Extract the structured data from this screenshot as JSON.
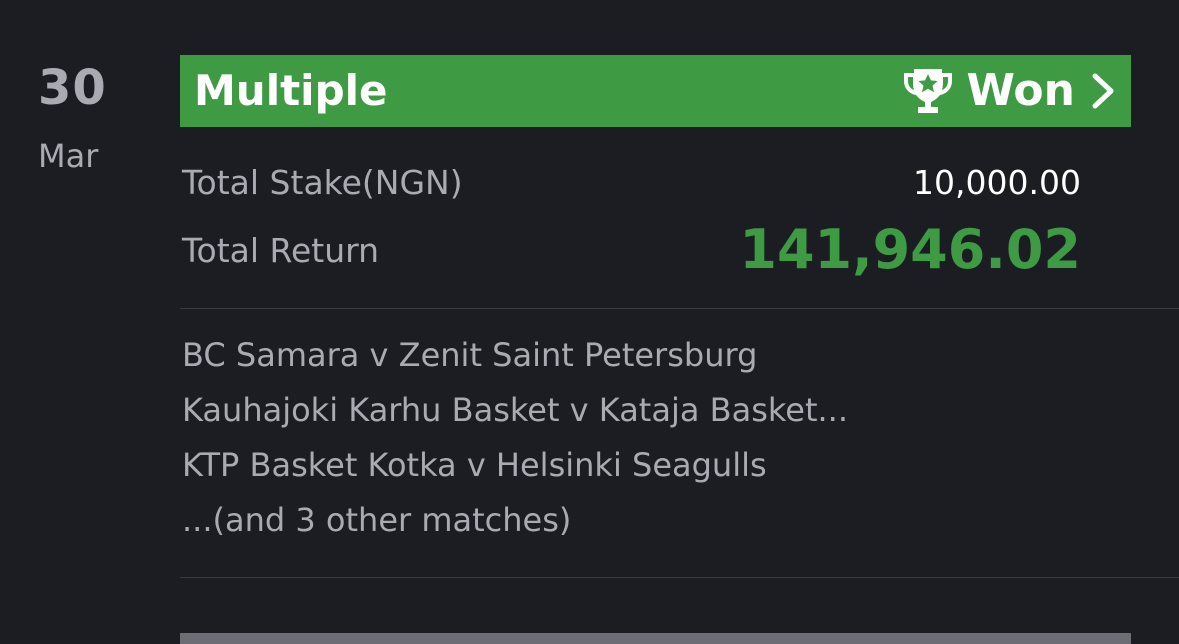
{
  "date": {
    "day": "30",
    "month": "Mar"
  },
  "bet": {
    "type": "Multiple",
    "status": "Won",
    "status_icon": "trophy-icon",
    "header_color": "#3f9b43",
    "total_stake_label": "Total Stake(NGN)",
    "total_stake_value": "10,000.00",
    "total_return_label": "Total Return",
    "total_return_value": "141,946.02",
    "return_color": "#3f9b43",
    "matches": [
      "BC Samara v Zenit Saint Petersburg",
      "Kauhajoki Karhu Basket v Kataja Basket...",
      "KTP Basket Kotka v Helsinki Seagulls",
      "...(and 3 other matches)"
    ]
  }
}
